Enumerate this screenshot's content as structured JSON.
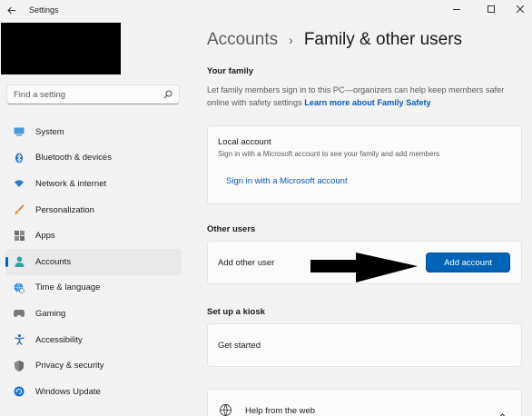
{
  "window": {
    "title": "Settings"
  },
  "search": {
    "placeholder": "Find a setting"
  },
  "sidebar": {
    "items": [
      {
        "label": "System",
        "icon": "monitor-icon"
      },
      {
        "label": "Bluetooth & devices",
        "icon": "bluetooth-icon"
      },
      {
        "label": "Network & internet",
        "icon": "wifi-icon"
      },
      {
        "label": "Personalization",
        "icon": "brush-icon"
      },
      {
        "label": "Apps",
        "icon": "apps-icon"
      },
      {
        "label": "Accounts",
        "icon": "person-icon",
        "active": true
      },
      {
        "label": "Time & language",
        "icon": "globe-clock-icon"
      },
      {
        "label": "Gaming",
        "icon": "gamepad-icon"
      },
      {
        "label": "Accessibility",
        "icon": "accessibility-icon"
      },
      {
        "label": "Privacy & security",
        "icon": "shield-icon"
      },
      {
        "label": "Windows Update",
        "icon": "update-icon"
      }
    ]
  },
  "breadcrumb": {
    "parent": "Accounts",
    "separator": "›",
    "current": "Family & other users"
  },
  "your_family": {
    "title": "Your family",
    "description": "Let family members sign in to this PC—organizers can help keep members safer online with safety settings",
    "link": "Learn more about Family Safety"
  },
  "local_account": {
    "title": "Local account",
    "subtitle": "Sign in with a Microsoft account to see your family and add members",
    "action": "Sign in with a Microsoft account"
  },
  "other_users": {
    "title": "Other users",
    "row_label": "Add other user",
    "button": "Add account"
  },
  "kiosk": {
    "title": "Set up a kiosk",
    "row_label": "Get started"
  },
  "help": {
    "label": "Help from the web"
  },
  "colors": {
    "accent": "#0063b8",
    "link": "#0a5bb8",
    "background": "#f3f3f3",
    "card": "#fbfbfb"
  }
}
